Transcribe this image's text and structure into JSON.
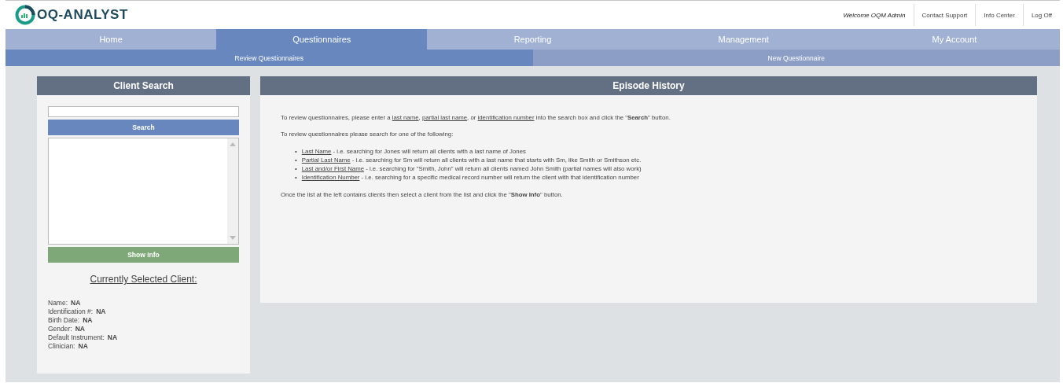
{
  "header": {
    "logo": "OQ-ANALYST",
    "welcome": "Welcome OQM Admin",
    "links": [
      "Contact Support",
      "Info Center",
      "Log Off"
    ]
  },
  "nav": [
    {
      "label": "Home",
      "selected": false
    },
    {
      "label": "Questionnaires",
      "selected": true
    },
    {
      "label": "Reporting",
      "selected": false
    },
    {
      "label": "Management",
      "selected": false
    },
    {
      "label": "My Account",
      "selected": false
    }
  ],
  "subnav": [
    {
      "label": "Review Questionnaires",
      "selected": true
    },
    {
      "label": "New Questionnaire",
      "selected": false
    }
  ],
  "client_search": {
    "title": "Client Search",
    "search_button": "Search",
    "show_info_button": "Show Info",
    "selected_title": "Currently Selected Client:",
    "fields": [
      {
        "label": "Name:",
        "value": "NA"
      },
      {
        "label": "Identification #:",
        "value": "NA"
      },
      {
        "label": "Birth Date:",
        "value": "NA"
      },
      {
        "label": "Gender:",
        "value": "NA"
      },
      {
        "label": "Default Instrument:",
        "value": "NA"
      },
      {
        "label": "Clinician:",
        "value": "NA"
      }
    ]
  },
  "episode_history": {
    "title": "Episode History",
    "intro": [
      {
        "kind": "plain",
        "text": "To review questionnaires, please enter a "
      },
      {
        "kind": "term",
        "text": "last name"
      },
      {
        "kind": "plain",
        "text": ", "
      },
      {
        "kind": "term",
        "text": "partial last name"
      },
      {
        "kind": "plain",
        "text": ", or "
      },
      {
        "kind": "term",
        "text": "identification number"
      },
      {
        "kind": "plain",
        "text": " into the search box and click the \""
      },
      {
        "kind": "bold",
        "text": "Search"
      },
      {
        "kind": "plain",
        "text": "\" button."
      }
    ],
    "list_intro": "To review questionnaires please search for one of the following:",
    "items": [
      {
        "bullet": "•",
        "term": "Last Name",
        "text": " - i.e. searching for Jones will return all clients with a last name of Jones"
      },
      {
        "bullet": "•",
        "term": "Partial Last Name",
        "text": " - i.e. searching for Sm will return all clients with a last name that starts with Sm, like Smith or Smithson etc."
      },
      {
        "bullet": "•",
        "term": "Last and/or First Name",
        "text": " - i.e. searching for \"Smith, John\" will return all clients named John Smith (partial names will also work)"
      },
      {
        "bullet": "•",
        "term": "Identification Number",
        "text": " - i.e. searching for a specific medical record number will return the client with that identification number"
      }
    ],
    "outro": [
      {
        "kind": "plain",
        "text": "Once the list at the left contains clients then select a client from the list and click the \""
      },
      {
        "kind": "bold",
        "text": "Show Info"
      },
      {
        "kind": "plain",
        "text": "\" button."
      }
    ]
  }
}
